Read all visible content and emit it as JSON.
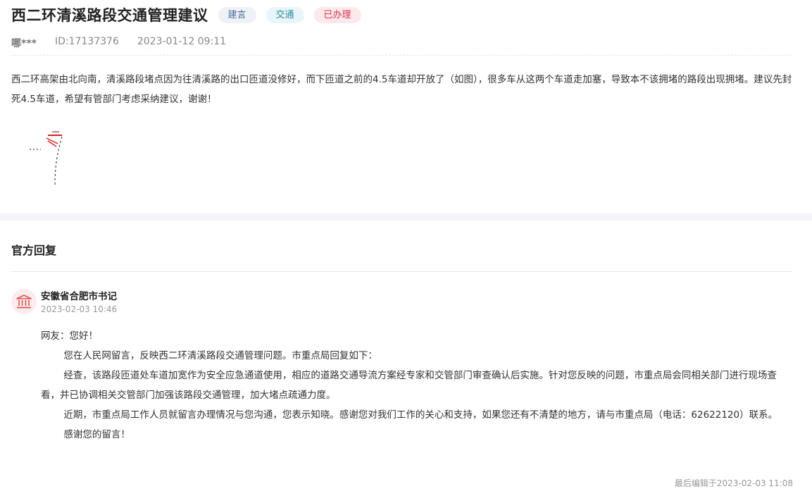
{
  "post": {
    "title": "西二环清溪路段交通管理建议",
    "tags": {
      "type": "建言",
      "category": "交通",
      "status": "已办理"
    },
    "author": "哪***",
    "id": "ID:17137376",
    "datetime": "2023-01-12 09:11",
    "content": "西二环高架由北向南，清溪路段堵点因为往清溪路的出口匝道没修好，而下匝道之前的4.5车道却开放了（如图），很多车从这两个车道走加塞，导致本不该拥堵的路段出现拥堵。建议先封死4.5车道，希望有管部门考虑采纳建议，谢谢！"
  },
  "reply": {
    "heading": "官方回复",
    "org_name": "安徽省合肥市书记",
    "time": "2023-02-03 10:46",
    "greeting": "网友：您好！",
    "paragraphs": [
      "您在人民网留言，反映西二环清溪路段交通管理问题。市重点局回复如下：",
      "经查，该路段匝道处车道加宽作为安全应急通道使用，相应的道路交通导流方案经专家和交管部门审查确认后实施。针对您反映的问题，市重点局会同相关部门进行现场查看，并已协调相关交管部门加强该路段交通管理，加大堵点疏通力度。",
      "近期，市重点局工作人员就留言办理情况与您沟通，您表示知晓。感谢您对我们工作的关心和支持，如果您还有不清楚的地方，请与市重点局（电话：62622120）联系。",
      "感谢您的留言！"
    ],
    "last_edited": "最后编辑于2023-02-03 11:08"
  },
  "icons": {
    "org_avatar": "government-building-icon",
    "photo": "road-map-thumbnail"
  },
  "colors": {
    "status_tag_text": "#d8374d",
    "category_tag_text": "#2d8aa8",
    "type_tag_text": "#4a6a9a",
    "avatar_bg": "#fdecec",
    "avatar_icon": "#e05050"
  }
}
